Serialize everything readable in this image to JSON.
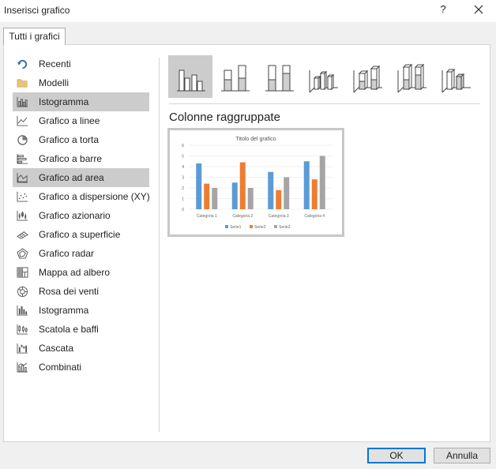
{
  "window": {
    "title": "Inserisci grafico",
    "help_label": "?"
  },
  "tabs": [
    {
      "label": "Tutti i grafici"
    }
  ],
  "sidebar": {
    "items": [
      {
        "label": "Recenti",
        "icon": "recent-icon",
        "selected": false
      },
      {
        "label": "Modelli",
        "icon": "folder-icon",
        "selected": false
      },
      {
        "label": "Istogramma",
        "icon": "column-chart-icon",
        "selected": true
      },
      {
        "label": "Grafico a linee",
        "icon": "line-chart-icon",
        "selected": false
      },
      {
        "label": "Grafico a torta",
        "icon": "pie-chart-icon",
        "selected": false
      },
      {
        "label": "Grafico a barre",
        "icon": "bar-chart-icon",
        "selected": false
      },
      {
        "label": "Grafico ad area",
        "icon": "area-chart-icon",
        "selected": true
      },
      {
        "label": "Grafico a dispersione (XY)",
        "icon": "scatter-chart-icon",
        "selected": false
      },
      {
        "label": "Grafico azionario",
        "icon": "stock-chart-icon",
        "selected": false
      },
      {
        "label": "Grafico a superficie",
        "icon": "surface-chart-icon",
        "selected": false
      },
      {
        "label": "Grafico radar",
        "icon": "radar-chart-icon",
        "selected": false
      },
      {
        "label": "Mappa ad albero",
        "icon": "treemap-icon",
        "selected": false
      },
      {
        "label": "Rosa dei venti",
        "icon": "sunburst-icon",
        "selected": false
      },
      {
        "label": "Istogramma",
        "icon": "histogram-icon",
        "selected": false
      },
      {
        "label": "Scatola e baffi",
        "icon": "box-whisker-icon",
        "selected": false
      },
      {
        "label": "Cascata",
        "icon": "waterfall-icon",
        "selected": false
      },
      {
        "label": "Combinati",
        "icon": "combo-chart-icon",
        "selected": false
      }
    ]
  },
  "subtypes": [
    {
      "name": "clustered-column",
      "selected": true
    },
    {
      "name": "stacked-column",
      "selected": false
    },
    {
      "name": "100-stacked-column",
      "selected": false
    },
    {
      "name": "3d-clustered-column",
      "selected": false
    },
    {
      "name": "3d-stacked-column",
      "selected": false
    },
    {
      "name": "3d-100-stacked-column",
      "selected": false
    },
    {
      "name": "3d-column",
      "selected": false
    }
  ],
  "variant_title": "Colonne raggruppate",
  "colors": {
    "series1": "#5b9bd5",
    "series2": "#ed7d31",
    "series3": "#a5a5a5",
    "selected": "#cccccc",
    "ok_border": "#0078d7"
  },
  "chart_data": {
    "type": "bar",
    "title": "Titolo del grafico",
    "categories": [
      "Categoria 1",
      "Categoria 2",
      "Categoria 3",
      "Categoria 4"
    ],
    "series": [
      {
        "name": "Serie1",
        "values": [
          4.3,
          2.5,
          3.5,
          4.5
        ]
      },
      {
        "name": "Serie2",
        "values": [
          2.4,
          4.4,
          1.8,
          2.8
        ]
      },
      {
        "name": "Serie3",
        "values": [
          2,
          2,
          3,
          5
        ]
      }
    ],
    "yticks": [
      "0",
      "1",
      "2",
      "3",
      "4",
      "5",
      "6"
    ],
    "ylim": [
      0,
      6
    ],
    "legend": "bottom",
    "grid": true
  },
  "buttons": {
    "ok": "OK",
    "cancel": "Annulla"
  }
}
